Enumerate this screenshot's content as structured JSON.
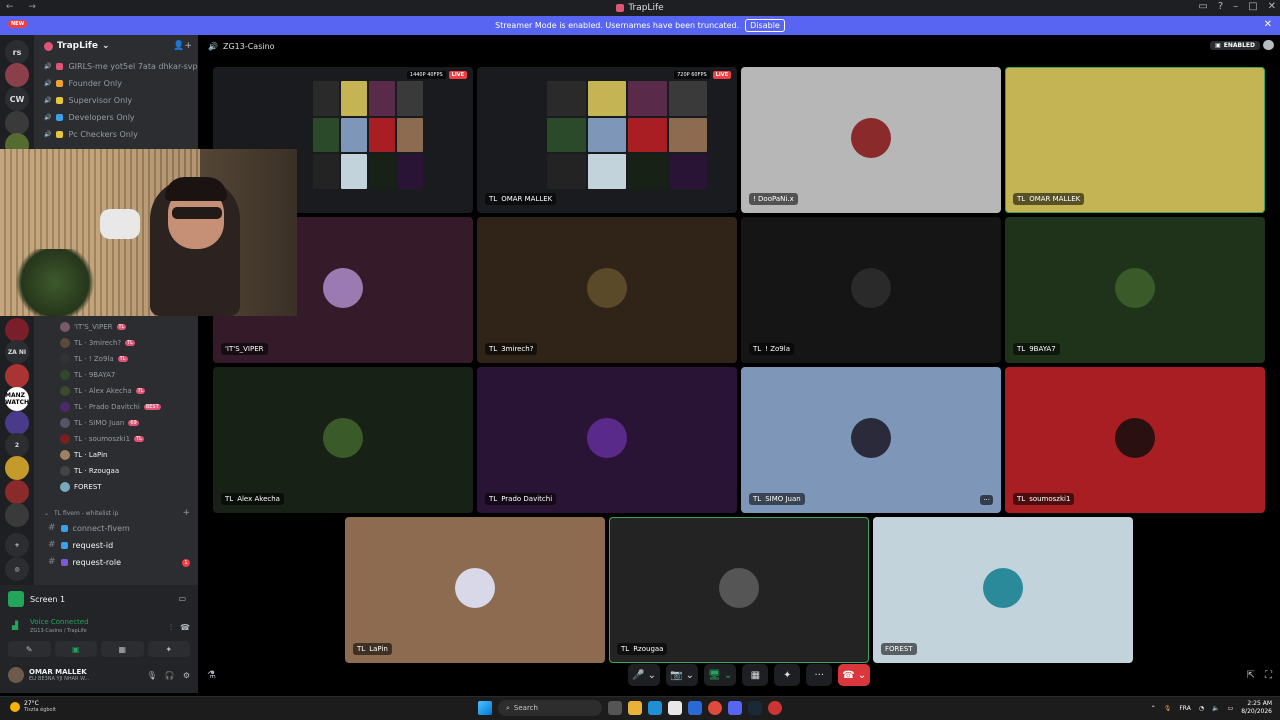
{
  "window": {
    "title": "TrapLife",
    "new_badge": "NEW"
  },
  "banner": {
    "text": "Streamer Mode is enabled. Usernames have been truncated.",
    "disable_label": "Disable",
    "close": "✕"
  },
  "rail": {
    "items": [
      {
        "label": "rs",
        "color": "#2b2d31"
      },
      {
        "label": "",
        "color": "#8a3f4a",
        "badge": "151"
      },
      {
        "label": "CW",
        "color": "#2b2d31"
      },
      {
        "label": "",
        "color": "#3a3a3a",
        "badge": "175"
      },
      {
        "label": "",
        "color": "#556b2f"
      }
    ],
    "lower": [
      {
        "label": "",
        "color": "#7a1f2a",
        "badge": "116"
      },
      {
        "label": "ZA NI",
        "color": "#2b2d31",
        "badge": "306"
      },
      {
        "label": "",
        "color": "#a33",
        "badge": "64"
      },
      {
        "label": "MANZ WATCH",
        "color": "#fff"
      },
      {
        "label": "",
        "color": "#4a3a8a",
        "badge": "385"
      },
      {
        "label": "2",
        "color": "#2b2d31"
      },
      {
        "label": "",
        "color": "#c49a2a",
        "badge": "101"
      },
      {
        "label": "",
        "color": "#8a2a2a",
        "badge": "45"
      },
      {
        "label": "",
        "color": "#3a3a3a",
        "badge": "24"
      },
      {
        "label": "+",
        "color": "#2b2d31"
      },
      {
        "label": "◎",
        "color": "#2b2d31"
      }
    ]
  },
  "sidebar": {
    "server_name": "TrapLife",
    "invite_icon": "👤+",
    "top_channels": [
      {
        "label": "GIRLS-me yot5el 7ata dhkar-svp",
        "color": "#e05575"
      },
      {
        "label": "Founder Only",
        "color": "#f0a030"
      },
      {
        "label": "Supervisor Only",
        "color": "#e9c53a"
      },
      {
        "label": "Developers Only",
        "color": "#3aa0e9"
      },
      {
        "label": "Pc Checkers Only",
        "color": "#e9c53a"
      }
    ],
    "members": [
      {
        "name": "'IT'S_VIPER",
        "tag": "TL",
        "color": "#7a5a6a"
      },
      {
        "name": "TL · 3mirech?",
        "tag": "TL",
        "color": "#5a4a3a"
      },
      {
        "name": "TL · ! Zo9la",
        "tag": "TL",
        "color": "#333"
      },
      {
        "name": "TL · 9BAYA7",
        "tag": "",
        "color": "#2e4a2a"
      },
      {
        "name": "TL · Alex Akecha",
        "tag": "TL",
        "color": "#3a4a2a"
      },
      {
        "name": "TL · Prado Davitchi",
        "tag": "BEST",
        "color": "#4a2a6a"
      },
      {
        "name": "TL · SIMO Juan",
        "tag": "69",
        "color": "#556"
      },
      {
        "name": "TL · soumoszki1",
        "tag": "TL",
        "color": "#7a1f1f"
      },
      {
        "name": "TL · LaPin",
        "tag": "",
        "color": "#a08060"
      },
      {
        "name": "TL · Rzougaa",
        "tag": "",
        "color": "#444"
      },
      {
        "name": "FOREST",
        "tag": "",
        "color": "#7ab"
      }
    ],
    "category": "TL fivem - whitelist ip",
    "channels": [
      {
        "label": "connect-fivem",
        "bright": false
      },
      {
        "label": "request-id",
        "bright": true
      },
      {
        "label": "request-role",
        "bright": true,
        "unread": "1"
      }
    ]
  },
  "call": {
    "channel_name": "ZG13-Casino",
    "enabled_label": "ENABLED",
    "tiles": [
      {
        "name": "OMAR MALLEK",
        "prefix": "TL",
        "bg": "#1a1b1e",
        "kind": "screen",
        "res": "1440P 40FPS",
        "live": "LIVE"
      },
      {
        "name": "OMAR MALLEK",
        "prefix": "TL",
        "bg": "#1a1b1e",
        "kind": "screen",
        "res": "720P 60FPS",
        "live": "LIVE"
      },
      {
        "name": "! DooPaNi.x",
        "prefix": "",
        "bg": "#b7b7b7",
        "avatar": "#8a2a2a"
      },
      {
        "name": "OMAR MALLEK",
        "prefix": "TL",
        "bg": "#c4b453",
        "avatar": "#c4b453"
      },
      {
        "name": "'IT'S_VIPER",
        "prefix": "",
        "bg": "#351b2a",
        "avatar": "#9a7ab0"
      },
      {
        "name": "3mirech?",
        "prefix": "TL",
        "bg": "#2f2417",
        "avatar": "#5a4a2a"
      },
      {
        "name": "! Zo9la",
        "prefix": "TL",
        "bg": "#151515",
        "avatar": "#2a2a2a"
      },
      {
        "name": "9BAYA7",
        "prefix": "TL",
        "bg": "#1f331b",
        "avatar": "#3a5a2a"
      },
      {
        "name": "Alex Akecha",
        "prefix": "TL",
        "bg": "#172116",
        "avatar": "#3a5a2a"
      },
      {
        "name": "Prado Davitchi",
        "prefix": "TL",
        "bg": "#2a1436",
        "avatar": "#5a2a8a"
      },
      {
        "name": "SIMO Juan",
        "prefix": "TL",
        "bg": "#7e97b8",
        "avatar": "#2a2a3a"
      },
      {
        "name": "soumoszki1",
        "prefix": "TL",
        "bg": "#a81e23",
        "avatar": "#2a1010"
      },
      {
        "name": "LaPin",
        "prefix": "TL",
        "bg": "#8c6b50",
        "avatar": "#d8d8e8"
      },
      {
        "name": "Rzougaa",
        "prefix": "TL",
        "bg": "#232323",
        "avatar": "#555"
      },
      {
        "name": "FOREST",
        "prefix": "",
        "bg": "#c3d3db",
        "avatar": "#2a8a9a"
      }
    ],
    "more_label": "···"
  },
  "user_panel": {
    "screen_label": "Screen 1",
    "voice_connected": "Voice Connected",
    "voice_sub": "ZG13-Casino / TrapLife",
    "username": "OMAR MALLEK",
    "status": "ELI BE3NA YJI NHAR W..."
  },
  "controls": {
    "mic": "🎤 ⌄",
    "camera": "📷 ⌄",
    "screen": "🖥 ⌄",
    "activity": "▦",
    "soundboard": "✦",
    "more": "···",
    "leave": "☎ ⌄"
  },
  "taskbar": {
    "temp": "27°C",
    "weather": "Tiszta égbolt",
    "search": "Search",
    "lang": "FRA",
    "time": "2:25 AM",
    "date": "8/20/2026"
  }
}
